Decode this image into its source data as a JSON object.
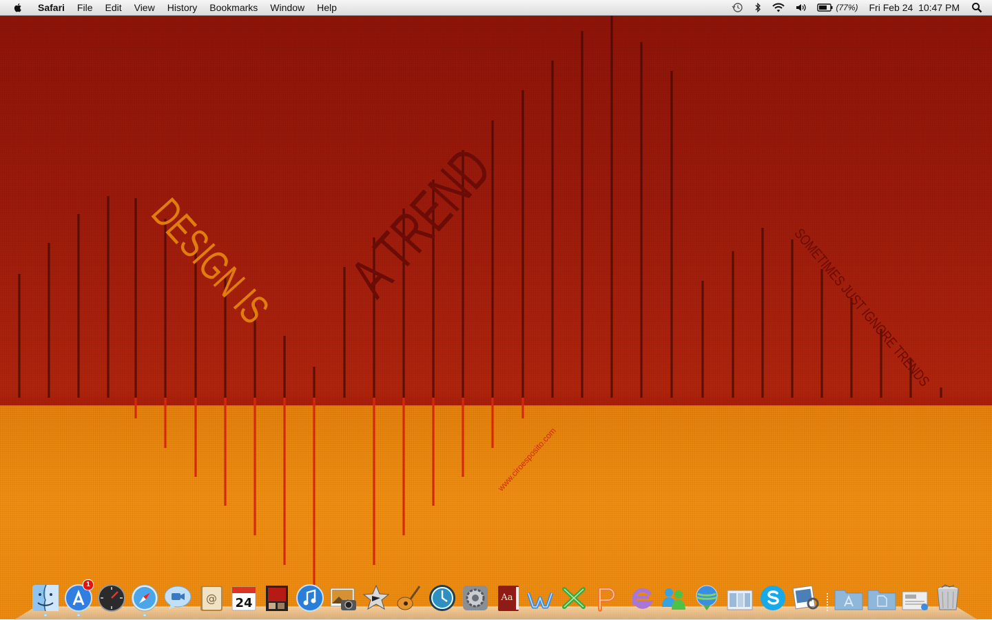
{
  "menubar": {
    "app_name": "Safari",
    "menus": [
      "File",
      "Edit",
      "View",
      "History",
      "Bookmarks",
      "Window",
      "Help"
    ],
    "status": {
      "battery_percent": "(77%)",
      "datetime": "Fri Feb 24  10:47 PM",
      "icons": [
        "time-machine-icon",
        "bluetooth-icon",
        "wifi-icon",
        "volume-icon",
        "battery-icon",
        "spotlight-icon"
      ]
    }
  },
  "wallpaper": {
    "headline_left": "DESIGN IS",
    "headline_right": "A TREND",
    "subline": "SOMETIMES JUST IGNORE TRENDS",
    "url": "www.ciroesposito.com",
    "colors": {
      "upper": "#9b1a0b",
      "lower": "#f08e12",
      "orange_text": "#e07d0d",
      "dark_text": "#6b0c06"
    }
  },
  "dock": {
    "apps": [
      {
        "name": "finder-icon",
        "running": true
      },
      {
        "name": "app-store-icon",
        "badge": "1",
        "running": true
      },
      {
        "name": "dashboard-icon"
      },
      {
        "name": "safari-icon",
        "running": true
      },
      {
        "name": "ichat-icon"
      },
      {
        "name": "address-book-icon"
      },
      {
        "name": "ical-icon",
        "date": "24"
      },
      {
        "name": "photo-booth-icon"
      },
      {
        "name": "itunes-icon"
      },
      {
        "name": "iphoto-icon"
      },
      {
        "name": "imovie-icon"
      },
      {
        "name": "garageband-icon"
      },
      {
        "name": "time-machine-icon"
      },
      {
        "name": "system-preferences-icon"
      },
      {
        "name": "dictionary-icon",
        "label": "Aa"
      },
      {
        "name": "word-icon"
      },
      {
        "name": "excel-icon"
      },
      {
        "name": "powerpoint-icon"
      },
      {
        "name": "entourage-icon"
      },
      {
        "name": "messenger-icon"
      },
      {
        "name": "network-icon"
      },
      {
        "name": "directory-icon"
      },
      {
        "name": "skype-icon"
      },
      {
        "name": "preview-icon"
      }
    ],
    "stacks": [
      "applications-folder-icon",
      "documents-folder-icon",
      "downloads-stack-icon",
      "trash-icon"
    ]
  }
}
